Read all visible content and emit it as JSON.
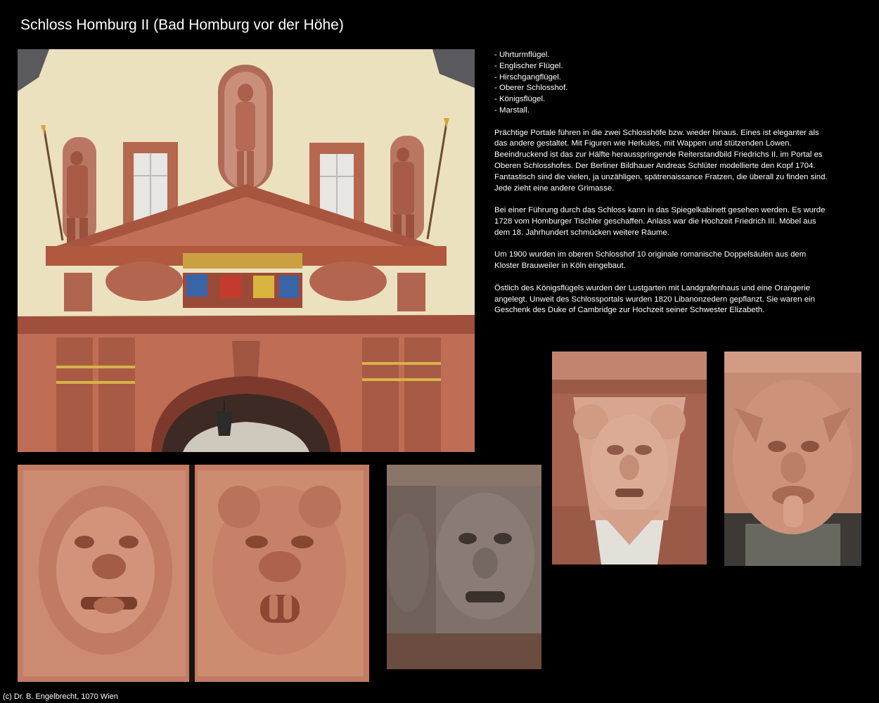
{
  "title": "Schloss Homburg II (Bad Homburg vor der Höhe)",
  "wings": [
    "- Uhrturmflügel.",
    "- Englischer Flügel.",
    "- Hirschgangflügel.",
    "- Oberer Schlosshof.",
    "- Königsflügel.",
    "- Marstall."
  ],
  "paragraphs": [
    "Prächtige Portale führen in die zwei Schlosshöfe bzw. wieder hinaus. Eines ist eleganter als das andere gestaltet. Mit Figuren wie Herkules, mit Wappen und stützenden Löwen. Beeindruckend ist das zur Hälfte herausspringende Reiterstandbild Friedrichs II. im Portal es Oberen Schlosshofes. Der Berliner Bildhauer Andreas Schlüter modellierte den Kopf 1704. Fantastisch sind die vielen, ja unzähligen, spätrenaissance Fratzen, die überall zu finden sind. Jede zieht eine andere Grimasse.",
    "Bei einer Führung durch das Schloss kann in das Spiegelkabinett gesehen werden. Es wurde 1728 vom Homburger Tischler geschaffen. Anlass war die Hochzeit Friedrich III. Möbel aus dem 18. Jahrhundert schmücken weitere Räume.",
    "Um 1900 wurden im oberen Schlosshof 10 originale romanische Doppelsäulen aus dem Kloster Brauweiler in Köln eingebaut.",
    "Östlich des Königsflügels wurden der Lustgarten mit Landgrafenhaus und eine Orangerie angelegt. Unweit des Schlossportals wurden 1820 Libanonzedern gepflanzt. Sie waren ein Geschenk des Duke of Cambridge zur Hochzeit seiner Schwester Elizabeth."
  ],
  "footer": "(c) Dr. B. Engelbrecht, 1070 Wien"
}
